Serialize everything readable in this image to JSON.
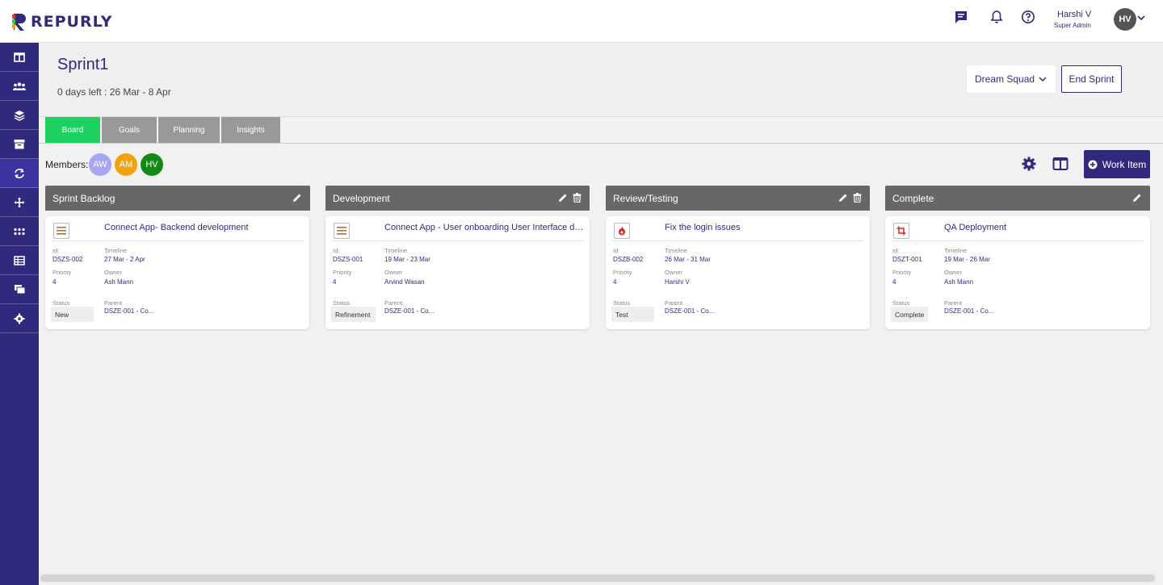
{
  "app": {
    "brand": "REPURLY"
  },
  "header": {
    "user_name": "Harshi V",
    "user_role": "Super Admin",
    "avatar_initials": "HV",
    "icons": [
      "chat-icon",
      "bell-icon",
      "help-icon"
    ]
  },
  "sidebar": {
    "items": [
      {
        "icon": "dashboard-icon"
      },
      {
        "icon": "team-icon"
      },
      {
        "icon": "layers-icon"
      },
      {
        "icon": "archive-icon"
      },
      {
        "icon": "sprint-cycle-icon",
        "active": true
      },
      {
        "icon": "move-icon"
      },
      {
        "icon": "apps-grid-icon"
      },
      {
        "icon": "table-icon"
      },
      {
        "icon": "board-icon"
      },
      {
        "icon": "settings-icon"
      }
    ]
  },
  "sprint": {
    "title": "Sprint1",
    "dates": "0 days left :  26 Mar - 8 Apr",
    "team": "Dream Squad",
    "end_label": "End Sprint"
  },
  "tabs": [
    "Board",
    "Goals",
    "Planning",
    "Insights"
  ],
  "members": {
    "label": "Members:",
    "list": [
      {
        "initials": "AW",
        "color": "#a6a6f2"
      },
      {
        "initials": "AM",
        "color": "#f4a20c"
      },
      {
        "initials": "HV",
        "color": "#138a13"
      }
    ]
  },
  "work_item_label": "Work Item",
  "colors": {
    "primary": "#2f2a7c",
    "active_tab": "#1cd15f",
    "column_header": "#676767"
  },
  "columns": [
    {
      "name": "Sprint Backlog",
      "card": {
        "type_icon": "story-icon",
        "title": "Connect App- Backend development",
        "id_label": "Id:",
        "id": "DSZS-002",
        "timeline_label": "Timeline",
        "timeline": "27 Mar - 2 Apr",
        "priority_label": "Priority",
        "priority": "4",
        "owner_label": "Owner",
        "owner": "Ash Mann",
        "status_label": "Status",
        "status": "New",
        "parent_label": "Parent",
        "parent": "DSZE-001 - Co..."
      }
    },
    {
      "name": "Development",
      "card": {
        "type_icon": "story-icon",
        "title": "Connect App - User onboarding User Interface de...",
        "id_label": "Id:",
        "id": "DSZS-001",
        "timeline_label": "Timeline",
        "timeline": "19 Mar - 23 Mar",
        "priority_label": "Priority",
        "priority": "4",
        "owner_label": "Owner",
        "owner": "Arvind Wasan",
        "status_label": "Status",
        "status": "Refinement",
        "parent_label": "Parent",
        "parent": "DSZE-001 - Co..."
      }
    },
    {
      "name": "Review/Testing",
      "card": {
        "type_icon": "bug-fire-icon",
        "title": "Fix the login issues",
        "id_label": "Id:",
        "id": "DSZB-002",
        "timeline_label": "Timeline",
        "timeline": "26 Mar - 31 Mar",
        "priority_label": "Priority",
        "priority": "4",
        "owner_label": "Owner",
        "owner": "Harshi V",
        "status_label": "Status",
        "status": "Test",
        "parent_label": "Parent",
        "parent": "DSZE-001 - Co..."
      }
    },
    {
      "name": "Complete",
      "card": {
        "type_icon": "task-crop-icon",
        "title": "QA Deployment",
        "id_label": "Id:",
        "id": "DSZT-001",
        "timeline_label": "Timeline",
        "timeline": "19 Mar - 26 Mar",
        "priority_label": "Priority",
        "priority": "4",
        "owner_label": "Owner",
        "owner": "Ash Mann",
        "status_label": "Status",
        "status": "Complete",
        "parent_label": "Parent",
        "parent": "DSZE-001 - Co..."
      }
    }
  ]
}
